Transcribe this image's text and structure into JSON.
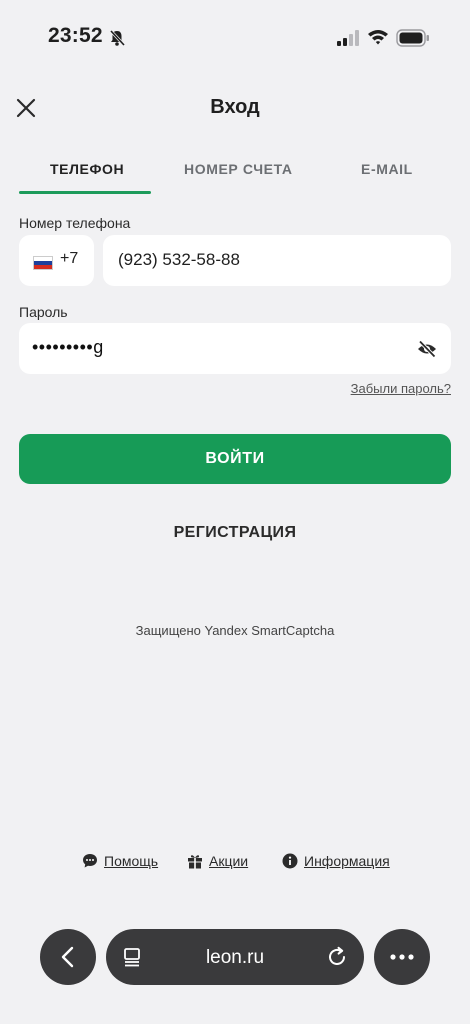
{
  "status_bar": {
    "time": "23:52"
  },
  "header": {
    "title": "Вход"
  },
  "tabs": [
    {
      "label": "ТЕЛЕФОН",
      "active": true
    },
    {
      "label": "НОМЕР СЧЕТА",
      "active": false
    },
    {
      "label": "E-MAIL",
      "active": false
    }
  ],
  "form": {
    "phone_label": "Номер телефона",
    "country_code": "+7",
    "phone_value": "(923) 532-58-88",
    "password_label": "Пароль",
    "password_value": "•••••••••g",
    "forgot_link": "Забыли пароль?"
  },
  "buttons": {
    "login": "ВОЙТИ",
    "register": "РЕГИСТРАЦИЯ"
  },
  "captcha_text": "Защищено Yandex SmartCaptcha",
  "footer": {
    "help": "Помощь",
    "promo": "Акции",
    "info": "Информация"
  },
  "browser": {
    "url": "leon.ru"
  },
  "colors": {
    "accent": "#179b57",
    "background": "#f1f1f3",
    "browser_bar": "#3a3a3c"
  }
}
